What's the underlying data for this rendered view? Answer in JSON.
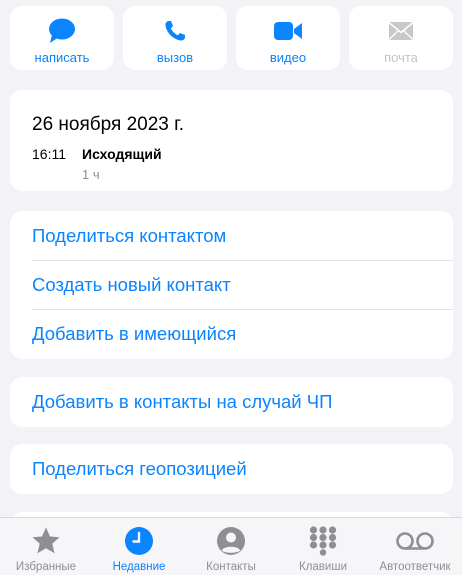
{
  "actions": [
    {
      "label": "написать",
      "icon": "message-icon",
      "enabled": true
    },
    {
      "label": "вызов",
      "icon": "phone-icon",
      "enabled": true
    },
    {
      "label": "видео",
      "icon": "video-icon",
      "enabled": true
    },
    {
      "label": "почта",
      "icon": "mail-icon",
      "enabled": false
    }
  ],
  "recent_call": {
    "date": "26 ноября 2023 г.",
    "time": "16:11",
    "type": "Исходящий",
    "duration": "1 ч"
  },
  "options": [
    "Поделиться контактом",
    "Создать новый контакт",
    "Добавить в имеющийся"
  ],
  "emergency": "Добавить в контакты на случай ЧП",
  "share_location": "Поделиться геопозицией",
  "tabs": [
    {
      "label": "Избранные",
      "icon": "star-icon",
      "active": false
    },
    {
      "label": "Недавние",
      "icon": "clock-icon",
      "active": true
    },
    {
      "label": "Контакты",
      "icon": "person-icon",
      "active": false
    },
    {
      "label": "Клавиши",
      "icon": "keypad-icon",
      "active": false
    },
    {
      "label": "Автоответчик",
      "icon": "voicemail-icon",
      "active": false
    }
  ],
  "colors": {
    "accent": "#0a84ff",
    "inactive": "#8e8e93",
    "background": "#f2f2f7",
    "card": "#ffffff"
  }
}
